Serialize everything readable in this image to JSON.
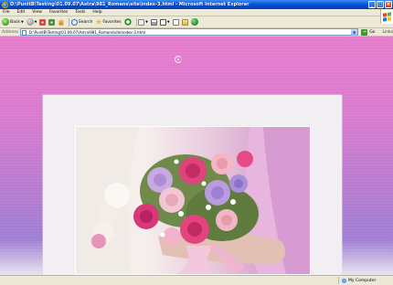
{
  "window": {
    "title": "D:\\PunitB\\Testing\\01.09.07\\Astra\\981_Romans\\site\\index-3.html - Microsoft Internet Explorer",
    "min_glyph": "_",
    "max_glyph": "□",
    "close_glyph": "×"
  },
  "menu": {
    "items": [
      {
        "label": "File"
      },
      {
        "label": "Edit"
      },
      {
        "label": "View"
      },
      {
        "label": "Favorites"
      },
      {
        "label": "Tools"
      },
      {
        "label": "Help"
      }
    ]
  },
  "toolbar": {
    "back_label": "Back",
    "search_label": "Search",
    "favorites_label": "Favorites"
  },
  "address": {
    "label": "Address",
    "value": "D:\\PunitB\\Testing\\01.09.07\\Astra\\981_Romans\\site\\index-3.html",
    "go_label": "Go",
    "links_label": "Links"
  },
  "status": {
    "text": "",
    "zone": "My Computer"
  },
  "colors": {
    "title_bar": "#0a55d8",
    "page_background_top": "#e67ccc",
    "page_background_bottom": "#9f7ed4",
    "panel": "#f2eff3"
  }
}
